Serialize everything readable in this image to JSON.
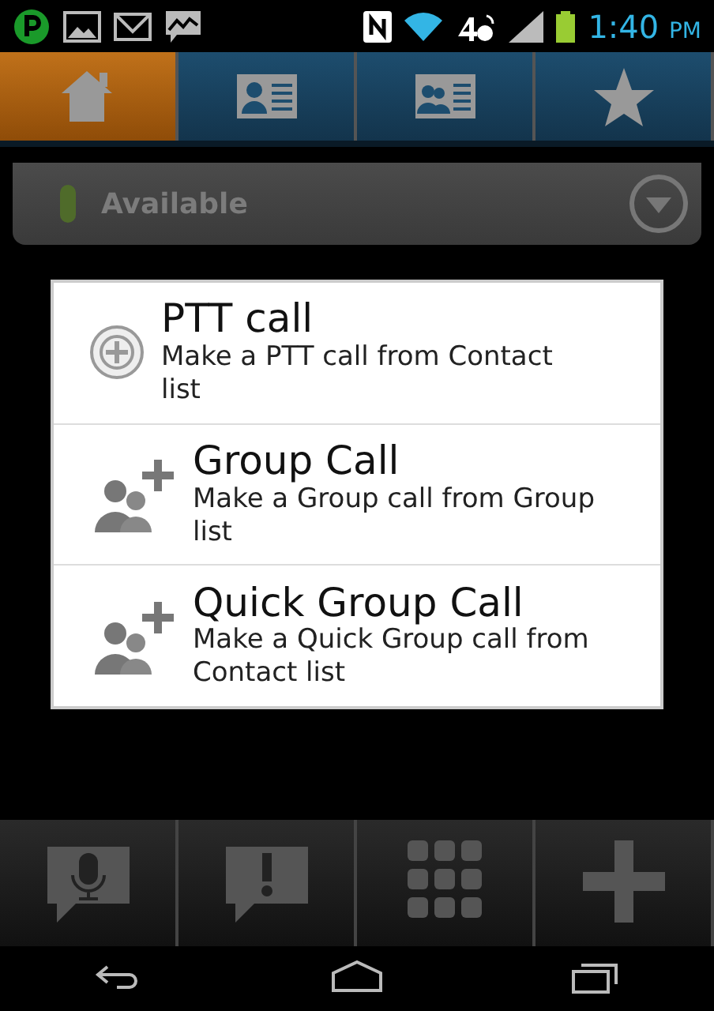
{
  "status_bar": {
    "time": "1:40",
    "period": "PM"
  },
  "tabs": [
    {
      "kind": "home",
      "selected": true
    },
    {
      "kind": "contact",
      "selected": false
    },
    {
      "kind": "group",
      "selected": false
    },
    {
      "kind": "star",
      "selected": false
    }
  ],
  "presence": {
    "label": "Available"
  },
  "dialog": {
    "options": [
      {
        "kind": "ptt",
        "title": "PTT call",
        "subtitle": "Make a PTT call from Contact list"
      },
      {
        "kind": "group",
        "title": "Group Call",
        "subtitle": "Make a Group call from Group list"
      },
      {
        "kind": "group",
        "title": "Quick Group Call",
        "subtitle": "Make a Quick Group call from Contact list"
      }
    ]
  },
  "toolbar": [
    {
      "kind": "mic"
    },
    {
      "kind": "alert"
    },
    {
      "kind": "keypad"
    },
    {
      "kind": "add"
    }
  ]
}
